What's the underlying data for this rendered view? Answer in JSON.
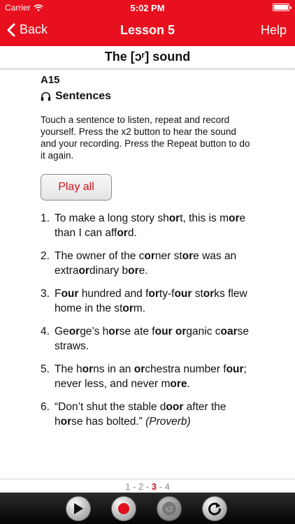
{
  "status": {
    "carrier": "Carrier",
    "time": "5:02 PM"
  },
  "nav": {
    "back_label": "Back",
    "title": "Lesson 5",
    "help_label": "Help"
  },
  "lesson": {
    "heading": "The [ɔʳ] sound",
    "code": "A15",
    "section_title": "Sentences",
    "instructions": "Touch a sentence to listen, repeat and record yourself. Press the x2 button to hear the sound and your recording. Press the Repeat button to do it again.",
    "play_all_label": "Play all"
  },
  "sentences": [
    {
      "num": "1.",
      "parts": [
        [
          "To make a long story sh",
          0
        ],
        [
          "or",
          1
        ],
        [
          "t, this is ",
          0
        ],
        [
          "m",
          0
        ],
        [
          "or",
          1
        ],
        [
          "e than I can aff",
          0
        ],
        [
          "or",
          1
        ],
        [
          "d.",
          0
        ]
      ]
    },
    {
      "num": "2.",
      "parts": [
        [
          "The owner of the c",
          0
        ],
        [
          "or",
          1
        ],
        [
          "ner st",
          0
        ],
        [
          "or",
          1
        ],
        [
          "e was an extra",
          0
        ],
        [
          "or",
          1
        ],
        [
          "dinary b",
          0
        ],
        [
          "or",
          1
        ],
        [
          "e.",
          0
        ]
      ]
    },
    {
      "num": "3.",
      "parts": [
        [
          "F",
          0
        ],
        [
          "our",
          1
        ],
        [
          " hundred and f",
          0
        ],
        [
          "or",
          1
        ],
        [
          "ty-f",
          0
        ],
        [
          "our",
          1
        ],
        [
          " st",
          0
        ],
        [
          "or",
          1
        ],
        [
          "ks flew home in the st",
          0
        ],
        [
          "or",
          1
        ],
        [
          "m.",
          0
        ]
      ]
    },
    {
      "num": "4.",
      "parts": [
        [
          "Ge",
          0
        ],
        [
          "or",
          1
        ],
        [
          "ge’s h",
          0
        ],
        [
          "or",
          1
        ],
        [
          "se ate f",
          0
        ],
        [
          "our",
          1
        ],
        [
          " ",
          0
        ],
        [
          "or",
          1
        ],
        [
          "ganic c",
          0
        ],
        [
          "oar",
          1
        ],
        [
          "se straws.",
          0
        ]
      ]
    },
    {
      "num": "5.",
      "parts": [
        [
          "The h",
          0
        ],
        [
          "or",
          1
        ],
        [
          "ns in an ",
          0
        ],
        [
          "or",
          1
        ],
        [
          "chestra number f",
          0
        ],
        [
          "our",
          1
        ],
        [
          "; never less, and never m",
          0
        ],
        [
          "ore",
          1
        ],
        [
          ".",
          0
        ]
      ]
    },
    {
      "num": "6.",
      "parts": [
        [
          "“Don’t shut the stable d",
          0
        ],
        [
          "oor",
          1
        ],
        [
          " after the h",
          0
        ],
        [
          "or",
          1
        ],
        [
          "se has bolted.” ",
          0
        ],
        [
          "(Proverb)",
          2
        ]
      ]
    }
  ],
  "pager": {
    "pages": [
      "1",
      "2",
      "3",
      "4"
    ],
    "current": "3",
    "separator": " - "
  },
  "controls": {
    "x2_label": "x2"
  },
  "colors": {
    "accent": "#e8101e",
    "highlight_text": "#d0121f"
  }
}
